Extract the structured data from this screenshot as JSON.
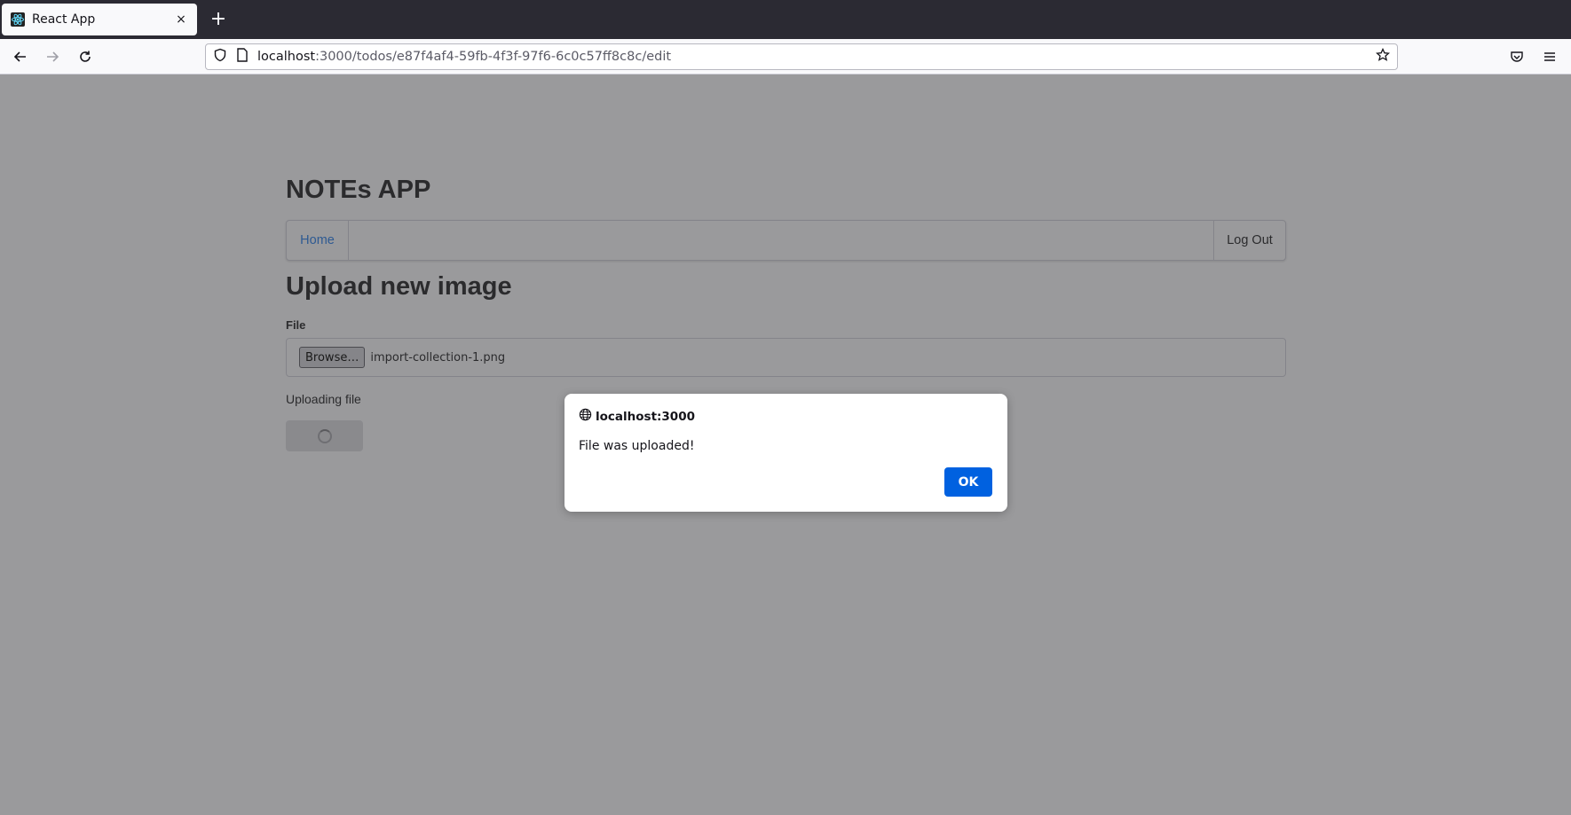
{
  "browser": {
    "tab": {
      "title": "React App",
      "close": "×"
    },
    "new_tab": "+",
    "url": {
      "host": "localhost",
      "path": ":3000/todos/e87f4af4-59fb-4f3f-97f6-6c0c57ff8c8c/edit"
    }
  },
  "app": {
    "title": "NOTEs APP",
    "menu": {
      "home": "Home",
      "logout": "Log Out"
    },
    "heading": "Upload new image",
    "file_label": "File",
    "browse_label": "Browse…",
    "file_name": "import-collection-1.png",
    "status": "Uploading file"
  },
  "dialog": {
    "origin": "localhost:3000",
    "message": "File was uploaded!",
    "ok_label": "OK",
    "ok_color": "#0061e0"
  },
  "icons": [
    "react-favicon-icon",
    "close-icon",
    "plus-icon",
    "back-arrow-icon",
    "forward-arrow-icon",
    "reload-icon",
    "shield-icon",
    "page-icon",
    "star-icon",
    "pocket-icon",
    "hamburger-menu-icon",
    "globe-icon",
    "spinner-icon"
  ]
}
